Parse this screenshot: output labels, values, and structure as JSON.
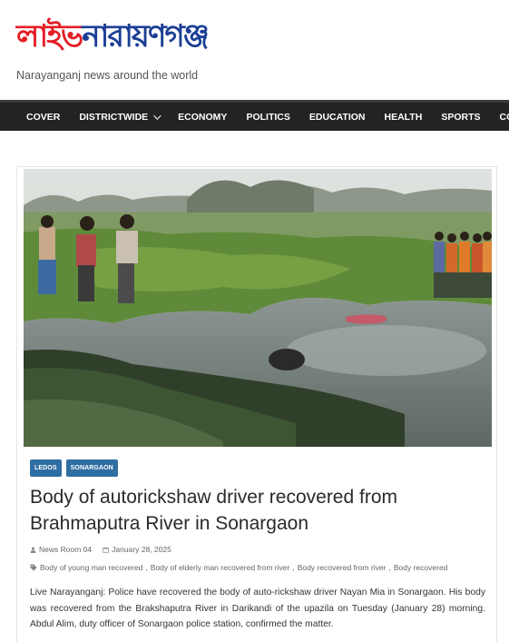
{
  "site": {
    "logo_red": "লাইভ",
    "logo_blue": "নারায়ণগঞ্জ",
    "tagline": "Narayanganj news around the world"
  },
  "nav": {
    "items": [
      "COVER",
      "DISTRICTWIDE",
      "ECONOMY",
      "POLITICS",
      "EDUCATION",
      "HEALTH",
      "SPORTS",
      "COURT"
    ]
  },
  "article": {
    "categories": [
      "LEDOS",
      "SONARGAON"
    ],
    "title": "Body of autorickshaw driver recovered from Brahmaputra River in Sonargaon",
    "author": "News Room 04",
    "date": "January 28, 2025",
    "tags": [
      "Body of young man recovered",
      "Body of elderly man recovered from river",
      "Body recovered from river",
      "Body recovered"
    ],
    "tag_separator": ",",
    "excerpt": "Live Narayanganj: Police have recovered the body of auto-rickshaw driver Nayan Mia in Sonargaon. His body was recovered from the Brakshaputra River in Darikandi of the upazila on Tuesday (January 28) morning. Abdul Alim, duty officer of Sonargaon police station, confirmed the matter."
  },
  "colors": {
    "logo_red": "#e41e26",
    "logo_blue": "#1b3f95",
    "nav_bg": "#232323",
    "category_bg": "#2f6ea2"
  }
}
